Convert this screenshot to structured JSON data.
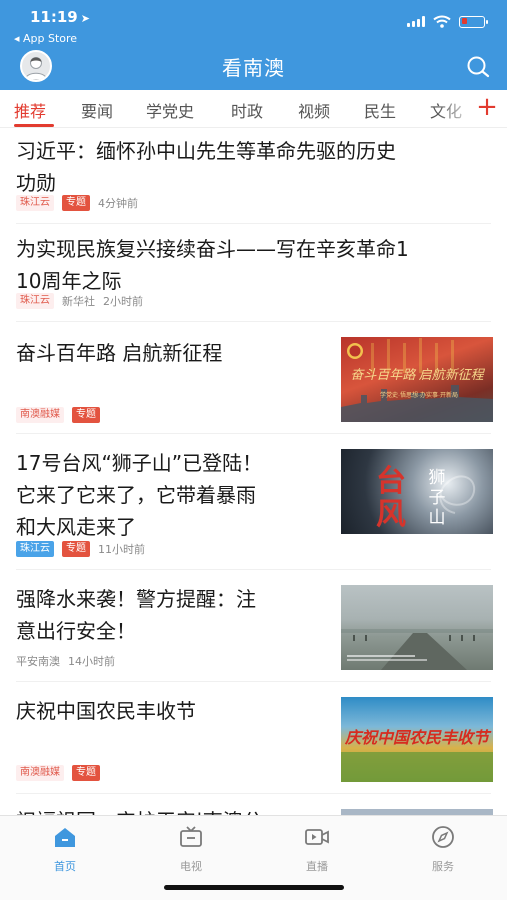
{
  "status_bar": {
    "time": "11:19",
    "back_app": "◂ App Store"
  },
  "header": {
    "title": "看南澳"
  },
  "tabs": [
    {
      "label": "推荐",
      "active": true
    },
    {
      "label": "要闻"
    },
    {
      "label": "学党史"
    },
    {
      "label": "时政"
    },
    {
      "label": "视频"
    },
    {
      "label": "民生"
    },
    {
      "label": "文化"
    }
  ],
  "feed": [
    {
      "title_lines": [
        "习近平：缅怀孙中山先生等革命先驱的历史",
        "功勋"
      ],
      "source": "珠江云",
      "tag": "专题",
      "time": "4分钟前"
    },
    {
      "title_lines": [
        "为实现民族复兴接续奋斗——写在辛亥革命1",
        "10周年之际"
      ],
      "source": "珠江云",
      "publisher": "新华社",
      "time": "2小时前"
    },
    {
      "title_lines": [
        "奋斗百年路 启航新征程"
      ],
      "source": "南澳融媒",
      "tag": "专题",
      "thumb_text": "奋斗百年路 启航新征程",
      "thumb_sub": "学党史·悟思想·办实事·开新局"
    },
    {
      "title_lines": [
        "17号台风“狮子山”已登陆！",
        "它来了它来了，它带着暴雨",
        "和大风走来了"
      ],
      "source": "珠江云",
      "tag": "专题",
      "time": "11小时前",
      "thumb_text_left": "台风",
      "thumb_text_right": "狮子山"
    },
    {
      "title_lines": [
        "强降水来袭！警方提醒：注",
        "意出行安全！"
      ],
      "source": "平安南澳",
      "time": "14小时前"
    },
    {
      "title_lines": [
        "庆祝中国农民丰收节"
      ],
      "source": "南澳融媒",
      "tag": "专题",
      "thumb_text": "庆祝中国农民丰收节"
    },
    {
      "title_lines": [
        "祝福祖国，守护平安|南澳公"
      ]
    }
  ],
  "bottom_nav": [
    {
      "label": "首页",
      "icon": "home-icon",
      "active": true
    },
    {
      "label": "电视",
      "icon": "tv-icon"
    },
    {
      "label": "直播",
      "icon": "live-video-icon"
    },
    {
      "label": "服务",
      "icon": "compass-icon"
    }
  ],
  "colors": {
    "header_blue": "#3f97de",
    "accent_red": "#e23b2f"
  }
}
